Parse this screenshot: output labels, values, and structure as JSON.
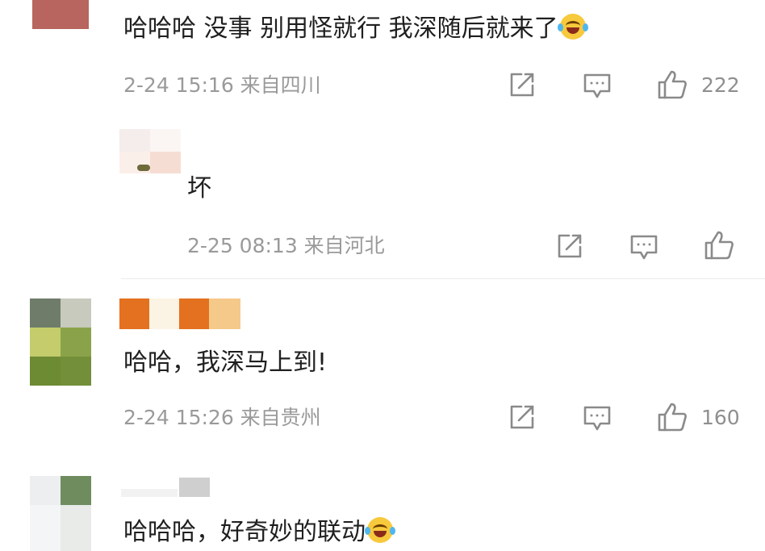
{
  "comments": [
    {
      "text": "哈哈哈 没事 别用怪就行 我深随后就来了",
      "emoji": "laugh-cry-emoji",
      "meta": "2-24 15:16 来自四川",
      "likes": "222"
    },
    {
      "text": "坏",
      "meta": "2-25 08:13 来自河北",
      "likes": ""
    },
    {
      "text": "哈哈，我深马上到!",
      "meta": "2-24 15:26 来自贵州",
      "likes": "160"
    },
    {
      "text": "哈哈哈，好奇妙的联动",
      "emoji": "laugh-cry-emoji"
    }
  ],
  "icons": {
    "share": "share-icon",
    "comment": "comment-icon",
    "like": "like-icon"
  },
  "colors": {
    "meta_text": "#9a9a9a",
    "icon_stroke": "#8a8a8a",
    "emoji": "#f7c93c"
  }
}
